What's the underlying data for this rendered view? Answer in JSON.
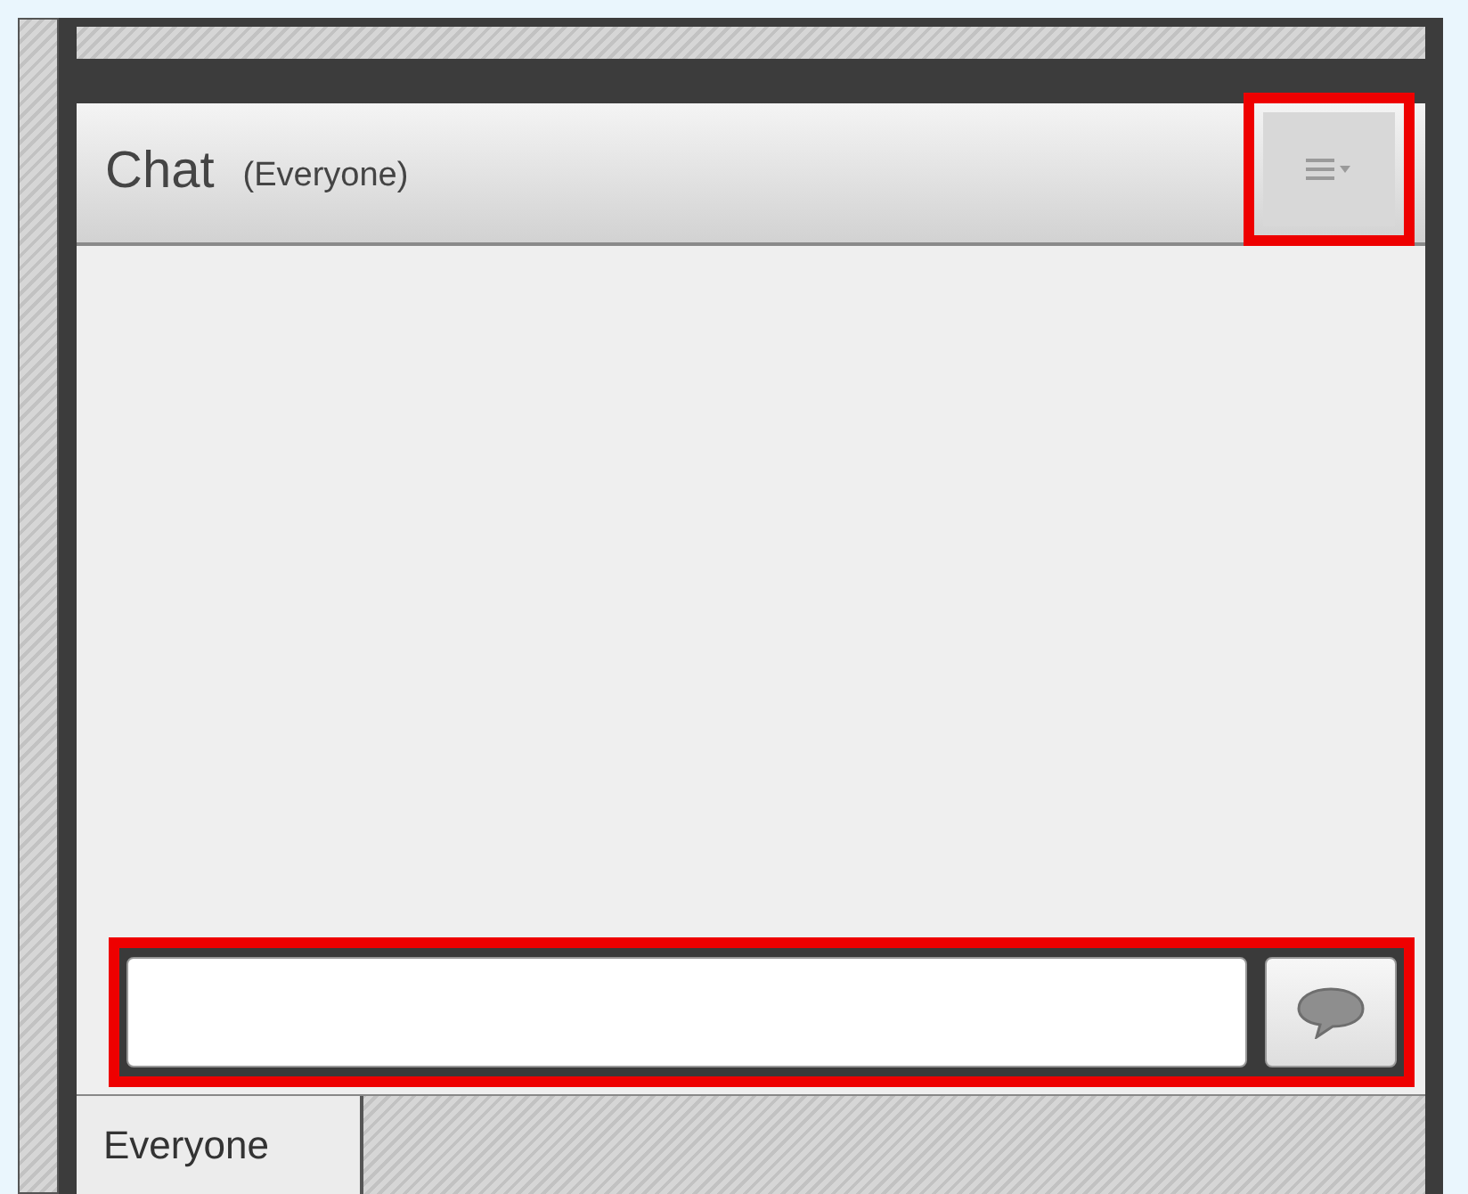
{
  "chat_pod": {
    "title": "Chat",
    "audience": "(Everyone)",
    "menu_button": {
      "highlighted": true
    },
    "message_row": {
      "highlighted": true
    },
    "tabs": [
      {
        "label": "Everyone",
        "selected": true
      }
    ]
  }
}
